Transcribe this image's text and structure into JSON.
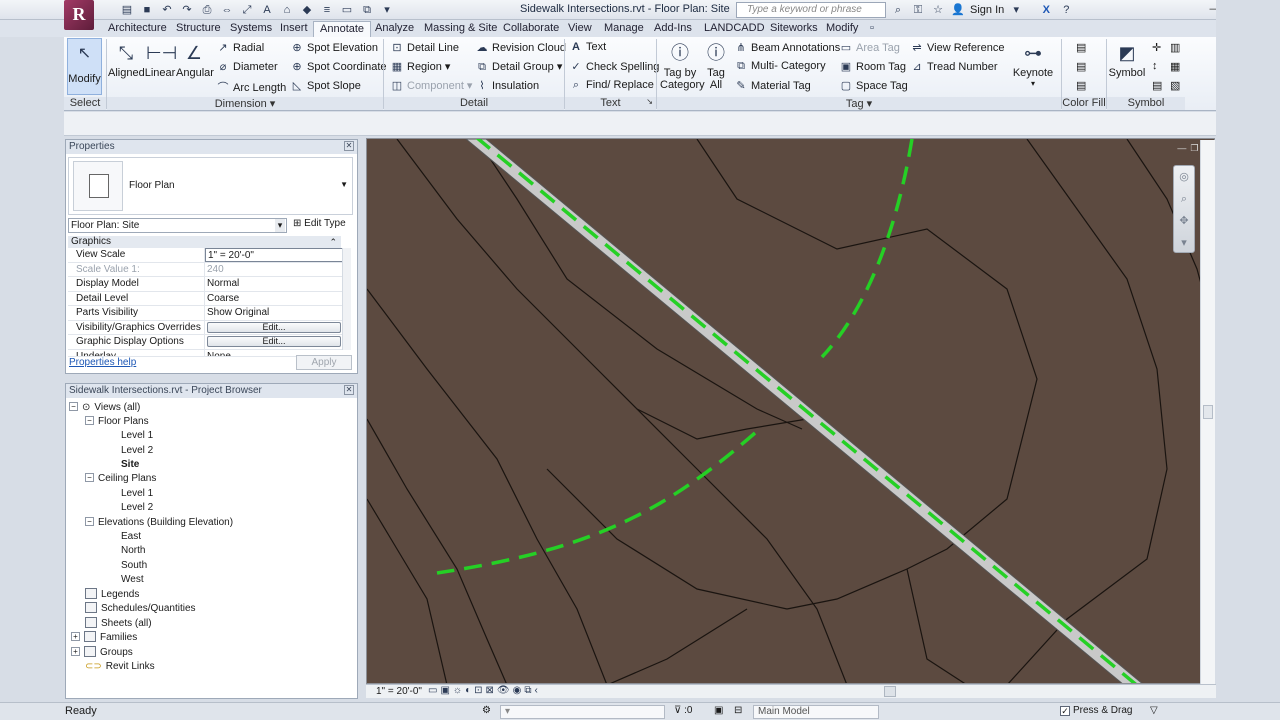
{
  "window": {
    "title": "Sidewalk Intersections.rvt - Floor Plan: Site",
    "search_placeholder": "Type a keyword or phrase",
    "sign_in": "Sign In"
  },
  "tabs": [
    "Architecture",
    "Structure",
    "Systems",
    "Insert",
    "Annotate",
    "Analyze",
    "Massing & Site",
    "Collaborate",
    "View",
    "Manage",
    "Add-Ins",
    "LANDCADD",
    "Siteworks",
    "Modify"
  ],
  "ribbon": {
    "select": {
      "modify": "Modify",
      "title": "Select"
    },
    "dimension": {
      "aligned": "Aligned",
      "linear": "Linear",
      "angular": "Angular",
      "radial": "Radial",
      "diameter": "Diameter",
      "arc_length": "Arc Length",
      "spot_elevation": "Spot Elevation",
      "spot_coordinate": "Spot Coordinate",
      "spot_slope": "Spot Slope",
      "title": "Dimension"
    },
    "detail": {
      "detail_line": "Detail Line",
      "region": "Region",
      "component": "Component",
      "revision_cloud": "Revision Cloud",
      "detail_group": "Detail Group",
      "insulation": "Insulation",
      "title": "Detail"
    },
    "text": {
      "text": "Text",
      "check_spelling": "Check Spelling",
      "find_replace": "Find/ Replace",
      "title": "Text"
    },
    "tag": {
      "tag_by_category": "Tag by Category",
      "tag_all": "Tag All",
      "beam_annotations": "Beam Annotations",
      "multi_category": "Multi- Category",
      "material_tag": "Material Tag",
      "area_tag": "Area Tag",
      "room_tag": "Room Tag",
      "space_tag": "Space Tag",
      "view_reference": "View Reference",
      "tread_number": "Tread Number",
      "keynote": "Keynote",
      "title": "Tag"
    },
    "color_fill": {
      "title": "Color Fill"
    },
    "symbol": {
      "symbol": "Symbol",
      "title": "Symbol"
    }
  },
  "properties": {
    "header": "Properties",
    "type_name": "Floor Plan",
    "instance": "Floor Plan: Site",
    "edit_type": "Edit Type",
    "group": "Graphics",
    "rows": [
      {
        "key": "View Scale",
        "value": "1\" = 20'-0\""
      },
      {
        "key": "Scale Value    1:",
        "value": "240"
      },
      {
        "key": "Display Model",
        "value": "Normal"
      },
      {
        "key": "Detail Level",
        "value": "Coarse"
      },
      {
        "key": "Parts Visibility",
        "value": "Show Original"
      },
      {
        "key": "Visibility/Graphics Overrides",
        "value": "Edit..."
      },
      {
        "key": "Graphic Display Options",
        "value": "Edit..."
      },
      {
        "key": "Underlay",
        "value": "None"
      }
    ],
    "help": "Properties help",
    "apply": "Apply"
  },
  "browser": {
    "header": "Sidewalk Intersections.rvt - Project Browser",
    "views_all": "Views (all)",
    "floor_plans": "Floor Plans",
    "fp_items": [
      "Level 1",
      "Level 2",
      "Site"
    ],
    "ceiling_plans": "Ceiling Plans",
    "cp_items": [
      "Level 1",
      "Level 2"
    ],
    "elevations": "Elevations (Building Elevation)",
    "el_items": [
      "East",
      "North",
      "South",
      "West"
    ],
    "legends": "Legends",
    "schedules": "Schedules/Quantities",
    "sheets": "Sheets (all)",
    "families": "Families",
    "groups": "Groups",
    "revit_links": "Revit Links"
  },
  "viewbar": {
    "scale": "1\" = 20'-0\""
  },
  "status": {
    "ready": "Ready",
    "count": ":0",
    "model": "Main Model",
    "press_drag": "Press & Drag"
  },
  "colors": {
    "canvas": "#5c4a40",
    "sidewalk": "#c9c9c9",
    "dashed": "#25d025",
    "accent": "#2b3a55"
  }
}
